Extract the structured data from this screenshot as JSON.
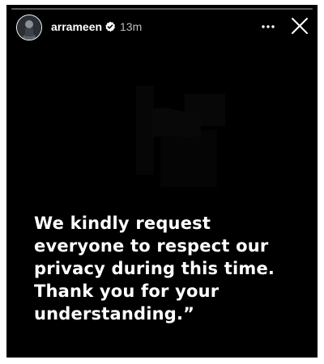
{
  "story": {
    "username": "arrameen",
    "verified": true,
    "timestamp": "13m",
    "progress": 0.0,
    "caption_lines": [
      "We kindly request",
      "everyone to respect our",
      "privacy during this time.",
      "Thank you for your",
      "understanding.”"
    ]
  },
  "icons": {
    "avatar": "profile-avatar",
    "verified": "verified-badge-icon",
    "more": "more-options-icon",
    "close": "close-icon"
  },
  "colors": {
    "background": "#000000",
    "text": "#ffffff",
    "timestamp": "#bdbdbd",
    "verified_badge": "#ffffff"
  }
}
